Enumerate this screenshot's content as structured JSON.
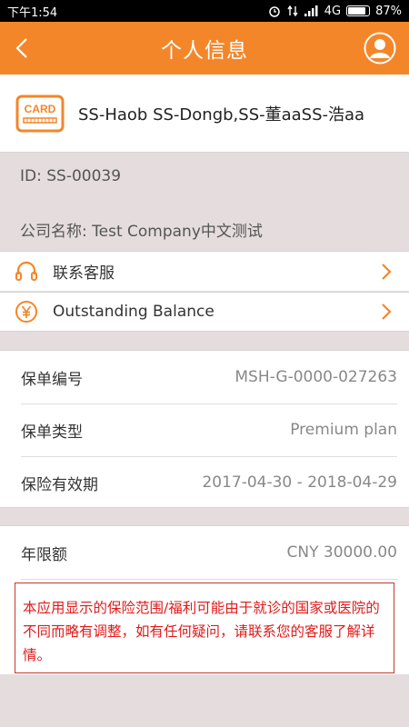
{
  "status_bar": {
    "time": "下午1:54",
    "network": "4G",
    "battery": "87%",
    "battery_level": 0.87,
    "icons": [
      "alarm-icon",
      "signal-icon",
      "signal-bars-icon",
      "battery-icon"
    ]
  },
  "header": {
    "title": "个人信息",
    "back_icon": "chevron-left-icon",
    "profile_icon": "user-avatar-icon",
    "bg_color": "#f4862a"
  },
  "card": {
    "icon_text": "CARD",
    "name": "SS-Haob SS-Dongb,SS-董aaSS-浩aa"
  },
  "info": {
    "id": "ID: SS-00039",
    "company": "公司名称: Test Company中文测试"
  },
  "menu": [
    {
      "icon": "headset-icon",
      "label": "联系客服"
    },
    {
      "icon": "yen-icon",
      "label": "Outstanding Balance"
    }
  ],
  "policy": {
    "number_label": "保单编号",
    "number_value": "MSH-G-0000-027263",
    "type_label": "保单类型",
    "type_value": "Premium plan",
    "validity_label": "保险有效期",
    "validity_value": "2017-04-30 - 2018-04-29"
  },
  "limit": {
    "label": "年限额",
    "value": "CNY 30000.00"
  },
  "notice": {
    "text": "本应用显示的保险范围/福利可能由于就诊的国家或医院的不同而略有调整，如有任何疑问，请联系您的客服了解详情。",
    "color": "#e01a1a"
  }
}
